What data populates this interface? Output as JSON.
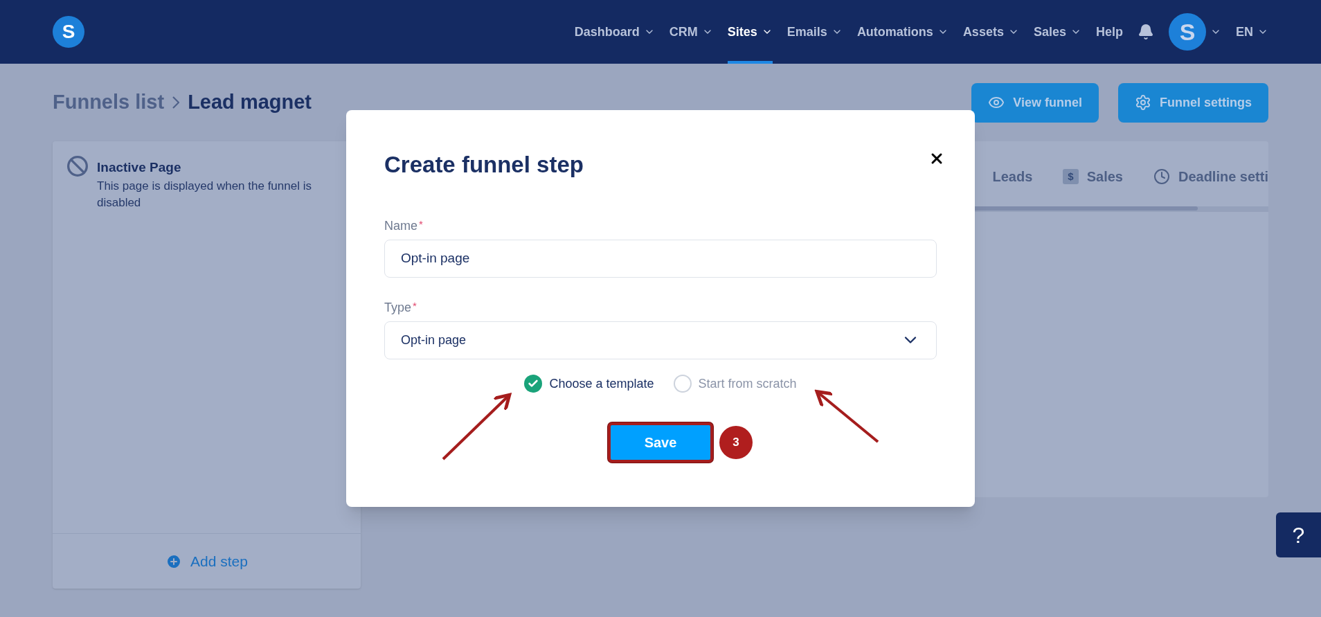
{
  "header": {
    "logo": "S",
    "nav": [
      {
        "label": "Dashboard",
        "selected": false,
        "dropdown": true
      },
      {
        "label": "CRM",
        "selected": false,
        "dropdown": true
      },
      {
        "label": "Sites",
        "selected": true,
        "dropdown": true
      },
      {
        "label": "Emails",
        "selected": false,
        "dropdown": true
      },
      {
        "label": "Automations",
        "selected": false,
        "dropdown": true
      },
      {
        "label": "Assets",
        "selected": false,
        "dropdown": true
      },
      {
        "label": "Sales",
        "selected": false,
        "dropdown": true
      },
      {
        "label": "Help",
        "selected": false,
        "dropdown": false
      }
    ],
    "avatar": "S",
    "language": "EN"
  },
  "breadcrumb": [
    "Funnels list",
    "Lead magnet"
  ],
  "actions": [
    {
      "label": "View funnel",
      "kind": "eye"
    },
    {
      "label": "Funnel settings",
      "kind": "gear"
    }
  ],
  "steps": [
    {
      "title": "Inactive Page",
      "description": "This page is displayed when the funnel is disabled"
    }
  ],
  "add_step": "Add step",
  "tabs": [
    {
      "label": "Leads",
      "kind": "plain"
    },
    {
      "label": "Sales",
      "kind": "dollar",
      "icon_text": "$"
    },
    {
      "label": "Deadline setti",
      "kind": "clock"
    }
  ],
  "modal": {
    "title": "Create funnel step",
    "fields": [
      {
        "label": "Name",
        "required_mark": "*",
        "value": "Opt-in page",
        "kind": "text"
      },
      {
        "label": "Type",
        "required_mark": "*",
        "value": "Opt-in page",
        "kind": "select"
      }
    ],
    "options": [
      {
        "label": "Choose a template",
        "selected": true
      },
      {
        "label": "Start from scratch",
        "selected": false
      }
    ],
    "save": "Save",
    "badge": "3"
  },
  "help": "?"
}
